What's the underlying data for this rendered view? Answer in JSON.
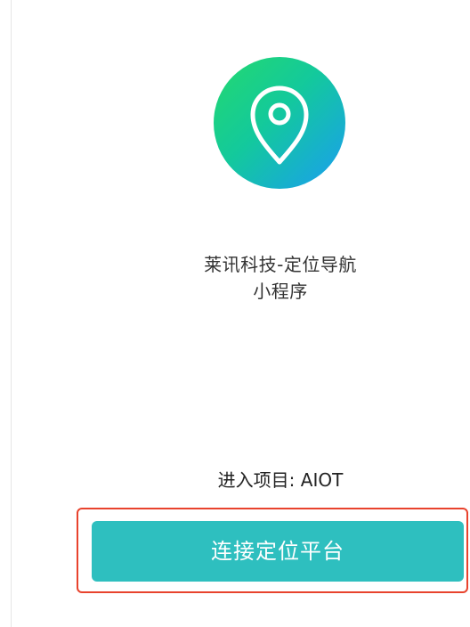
{
  "app": {
    "name_line1": "莱讯科技-定位导航",
    "name_line2": "小程序",
    "logo_icon": "location-pin-icon"
  },
  "project": {
    "label": "进入项目: AIOT"
  },
  "actions": {
    "connect_label": "连接定位平台"
  },
  "colors": {
    "button": "#2ebfbf",
    "highlight": "#e8432d",
    "logo_gradient_start": "#24d96e",
    "logo_gradient_end": "#1a9df2"
  }
}
